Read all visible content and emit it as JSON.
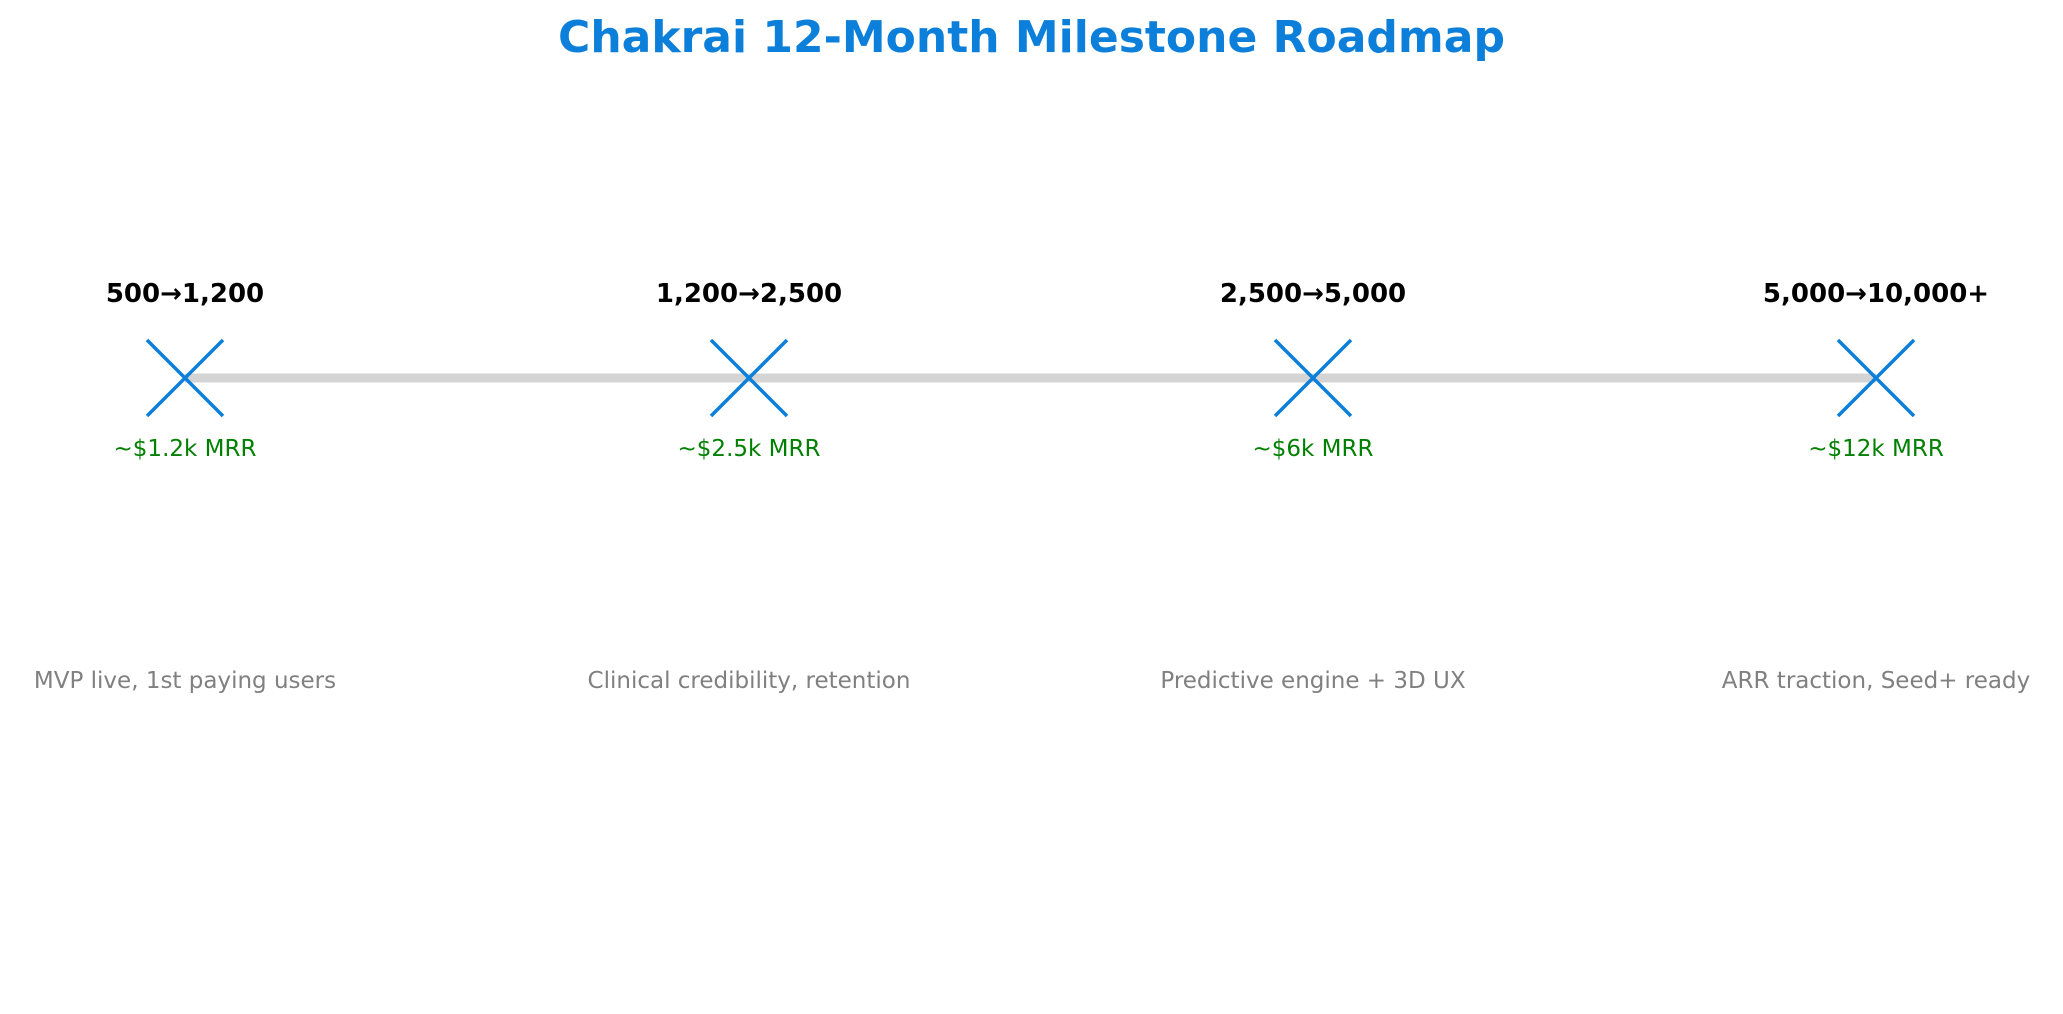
{
  "title": "Chakrai 12-Month Milestone Roadmap",
  "colors": {
    "title": "#0b7fd9",
    "marker": "#0b7fd9",
    "timeline": "#d4d4d4",
    "users": "#000000",
    "mrr": "#008000",
    "goal": "#808080"
  },
  "milestones": [
    {
      "users": "500→1,200",
      "mrr": "~$1.2k MRR",
      "goal": "MVP live, 1st paying users",
      "marker_icon": "x-marker-icon"
    },
    {
      "users": "1,200→2,500",
      "mrr": "~$2.5k MRR",
      "goal": "Clinical credibility, retention",
      "marker_icon": "x-marker-icon"
    },
    {
      "users": "2,500→5,000",
      "mrr": "~$6k MRR",
      "goal": "Predictive engine + 3D UX",
      "marker_icon": "x-marker-icon"
    },
    {
      "users": "5,000→10,000+",
      "mrr": "~$12k MRR",
      "goal": "ARR traction, Seed+ ready",
      "marker_icon": "x-marker-icon"
    }
  ]
}
